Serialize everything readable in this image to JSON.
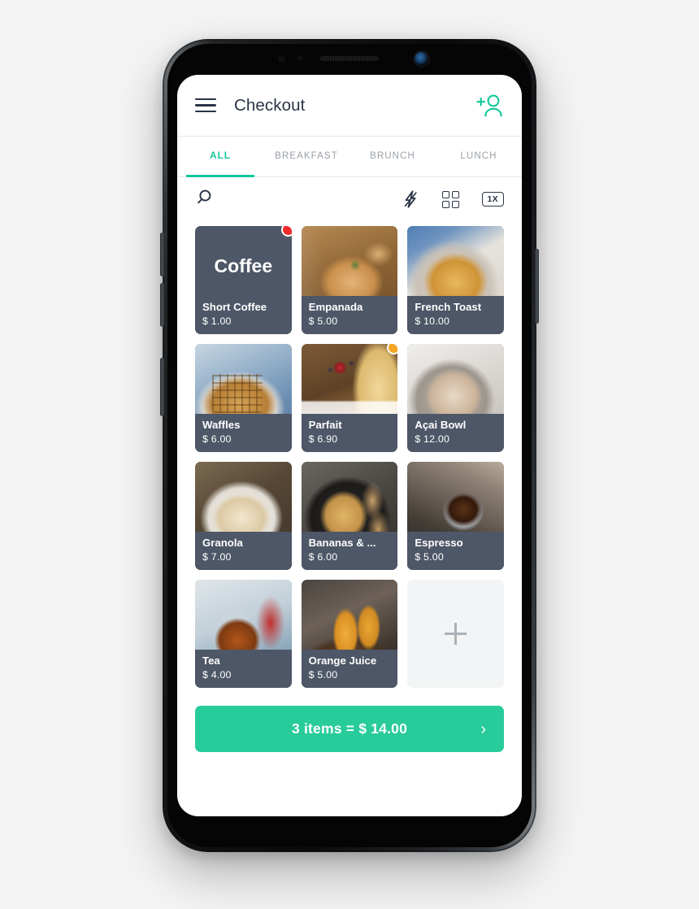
{
  "app_bar": {
    "menu_icon": "hamburger-icon",
    "title": "Checkout",
    "action_icon": "add-person-icon"
  },
  "tabs": [
    {
      "label": "ALL",
      "active": true
    },
    {
      "label": "BREAKFAST",
      "active": false
    },
    {
      "label": "BRUNCH",
      "active": false
    },
    {
      "label": "LUNCH",
      "active": false
    }
  ],
  "toolbar": {
    "search_icon": "search-icon",
    "flash_icon": "lightning-bolt-icon",
    "grid_icon": "grid-view-icon",
    "zoom_badge": "1X"
  },
  "products": [
    {
      "name": "Short Coffee",
      "price": "$ 1.00",
      "display_title": "Coffee",
      "photo": "",
      "badge": "#ef2b2b"
    },
    {
      "name": "Empanada",
      "price": "$ 5.00",
      "display_title": "",
      "photo": "ph-empanada",
      "badge": ""
    },
    {
      "name": "French Toast",
      "price": "$ 10.00",
      "display_title": "",
      "photo": "ph-frenchtoast",
      "badge": ""
    },
    {
      "name": "Waffles",
      "price": "$ 6.00",
      "display_title": "",
      "photo": "ph-waffles",
      "badge": ""
    },
    {
      "name": "Parfait",
      "price": "$ 6.90",
      "display_title": "",
      "photo": "ph-parfait",
      "badge": "#f5a623"
    },
    {
      "name": "Açai Bowl",
      "price": "$ 12.00",
      "display_title": "",
      "photo": "ph-acai",
      "badge": ""
    },
    {
      "name": "Granola",
      "price": "$ 7.00",
      "display_title": "",
      "photo": "ph-granola",
      "badge": ""
    },
    {
      "name": "Bananas & ...",
      "price": "$ 6.00",
      "display_title": "",
      "photo": "ph-bananas",
      "badge": ""
    },
    {
      "name": "Espresso",
      "price": "$ 5.00",
      "display_title": "",
      "photo": "ph-espresso",
      "badge": ""
    },
    {
      "name": "Tea",
      "price": "$ 4.00",
      "display_title": "",
      "photo": "ph-tea",
      "badge": ""
    },
    {
      "name": "Orange Juice",
      "price": "$ 5.00",
      "display_title": "",
      "photo": "ph-oj",
      "badge": ""
    }
  ],
  "add_tile": {
    "icon": "plus-icon"
  },
  "checkout": {
    "label": "3 items = $ 14.00",
    "item_count": 3,
    "total": "$ 14.00",
    "chevron": "›"
  },
  "colors": {
    "accent_green": "#14c79a",
    "checkout_green": "#28cb9a",
    "card_slate": "#4e5767",
    "text_dark": "#2b3446",
    "tab_inactive": "#9aa0a6",
    "badge_red": "#ef2b2b",
    "badge_orange": "#f5a623"
  },
  "device": {
    "earpiece": "speaker-grille",
    "camera": "front-camera",
    "buttons": [
      "volume-up",
      "volume-down",
      "bixby",
      "power"
    ]
  }
}
